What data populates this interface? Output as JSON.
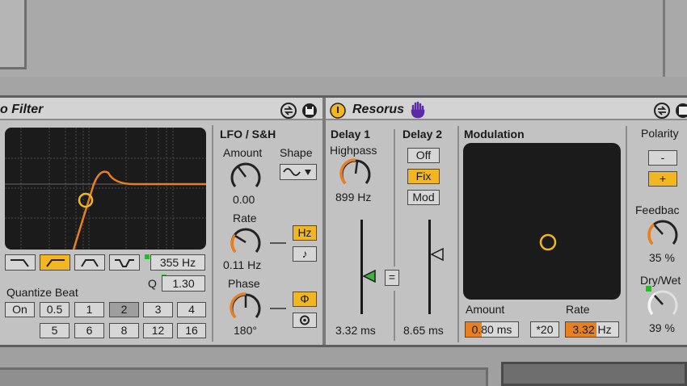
{
  "auto_filter": {
    "title": "o Filter",
    "filter_types": [
      "lowpass",
      "highpass",
      "bandpass",
      "notch"
    ],
    "selected_filter_type": "highpass",
    "frequency": "355 Hz",
    "q_label": "Q",
    "q_value": "1.30",
    "quantize_label": "Quantize Beat",
    "quantize_row1": [
      "On",
      "0.5",
      "1",
      "2",
      "3",
      "4"
    ],
    "quantize_row2": [
      "5",
      "6",
      "8",
      "12",
      "16"
    ],
    "quantize_selected": "2",
    "lfo": {
      "heading": "LFO / S&H",
      "amount_label": "Amount",
      "amount_value": "0.00",
      "shape_label": "Shape",
      "rate_label": "Rate",
      "rate_value": "0.11 Hz",
      "hz_button": "Hz",
      "phase_label": "Phase",
      "phase_value": "180°",
      "phi_button": "Φ"
    }
  },
  "resorus": {
    "title": "Resorus",
    "delay1": {
      "heading": "Delay 1",
      "highpass_label": "Highpass",
      "highpass_value": "899 Hz",
      "time": "3.32 ms"
    },
    "link_button": "=",
    "delay2": {
      "heading": "Delay 2",
      "off_button": "Off",
      "fix_button": "Fix",
      "mod_button": "Mod",
      "time": "8.65 ms"
    },
    "modulation": {
      "heading": "Modulation",
      "amount_label": "Amount",
      "amount_value": "0.80 ms",
      "rate_label": "Rate",
      "rate_mult": "*20",
      "rate_value": "3.32",
      "rate_unit": "Hz"
    },
    "polarity": {
      "heading": "Polarity",
      "minus": "-",
      "plus": "+"
    },
    "feedback_label": "Feedbac",
    "feedback_value": "35 %",
    "drywet_label": "Dry/Wet",
    "drywet_value": "39 %"
  },
  "colors": {
    "accent_orange": "#e8801e",
    "button_on_yellow": "#f2b620",
    "screen_dark": "#1b1b1b"
  }
}
